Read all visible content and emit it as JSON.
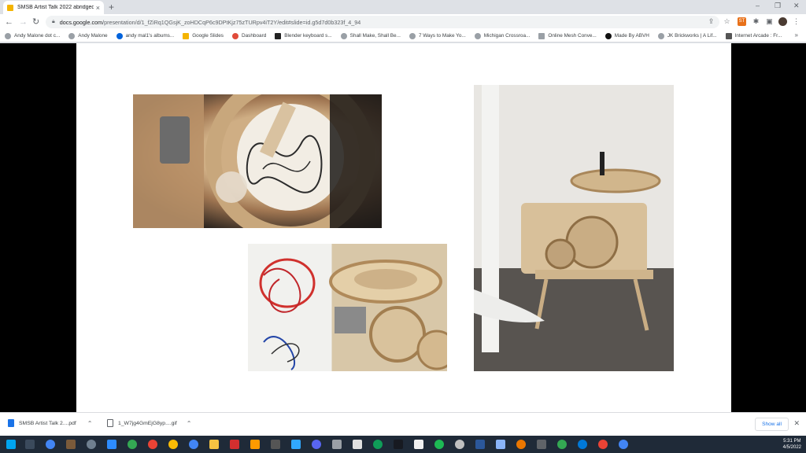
{
  "browser": {
    "tab_title": "SMSB Artist Talk 2022 abridged",
    "tab_close": "×",
    "new_tab": "+",
    "url_host": "docs.google.com",
    "url_rest": "/presentation/d/1_fZiRq1QGsjK_zoHDCqP6c9DPtKjz75zTURpv4iT2Y/edit#slide=id.g5d7d0b323f_4_94",
    "window_controls": [
      "–",
      "❐",
      "✕"
    ]
  },
  "bookmarks": [
    "Andy Malone dot c...",
    "Andy Malone",
    "andy mal1's albums...",
    "Google Slides",
    "Dashboard",
    "Blender keyboard s...",
    "Shall Make, Shall Be...",
    "7 Ways to Make Yo...",
    "Michigan Crossroa...",
    "Online Mesh Conve...",
    "Made By ABVH",
    "JK Brickworks | A Lif...",
    "Internet Arcade : Fr..."
  ],
  "bookmarks_more": "»",
  "downloads": {
    "items": [
      {
        "name": "SMSB Artist Talk 2....pdf"
      },
      {
        "name": "1_W7jg4GmEjG8yp....gif"
      }
    ],
    "show_all": "Show all",
    "close": "✕"
  },
  "taskbar": {
    "time": "5:31 PM",
    "date": "4/5/2022"
  },
  "colors": {
    "chrome_bg": "#dee1e6",
    "accent": "#1a73e8",
    "taskbar": "#1f2a38"
  }
}
